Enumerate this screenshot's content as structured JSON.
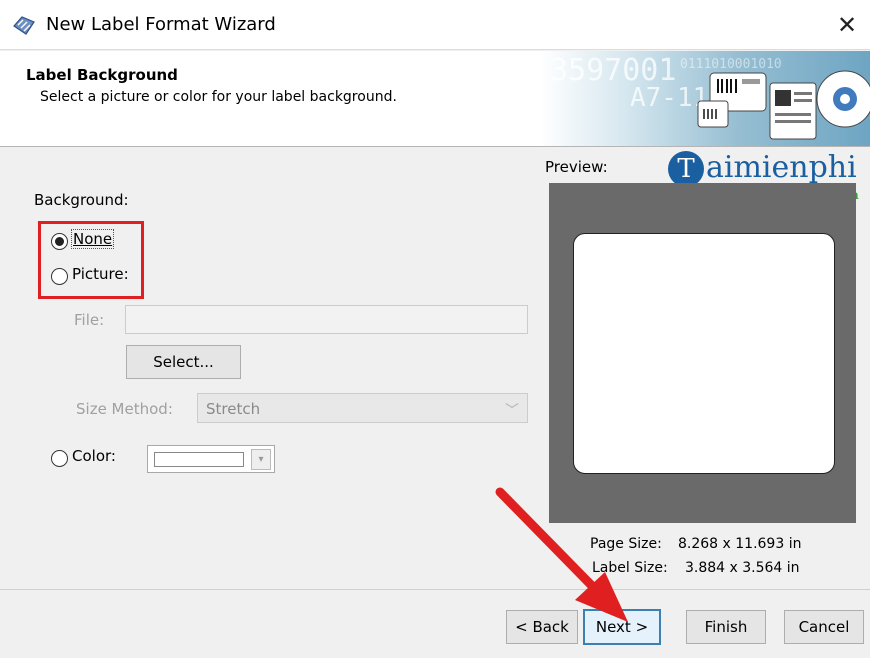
{
  "window": {
    "title": "New Label Format Wizard",
    "close_glyph": "✕",
    "icon": "bartender-app-icon"
  },
  "header": {
    "title": "Label Background",
    "subtitle": "Select a picture or color for your label background.",
    "banner_text_1": "3597001",
    "banner_text_2": "A7-118",
    "banner_text_3": "0111010001010"
  },
  "background": {
    "group_label": "Background:",
    "none_label": "None",
    "picture_label": "Picture:",
    "color_label": "Color:",
    "selected": "None"
  },
  "file": {
    "label": "File:",
    "value": "",
    "select_button": "Select..."
  },
  "size_method": {
    "label": "Size Method:",
    "value": "Stretch"
  },
  "preview": {
    "label": "Preview:",
    "page_size_label": "Page Size:",
    "page_size_value": "8.268 x 11.693 in",
    "label_size_label": "Label Size:",
    "label_size_value": "3.884 x 3.564 in"
  },
  "watermark": {
    "letter": "T",
    "text": "aimienphi",
    "sub": "vn"
  },
  "footer": {
    "back": "< Back",
    "next": "Next >",
    "finish": "Finish",
    "cancel": "Cancel"
  },
  "colors": {
    "annotation_red": "#e02020",
    "focus_blue": "#3c7fb1",
    "watermark_blue": "#1a5fa0"
  }
}
